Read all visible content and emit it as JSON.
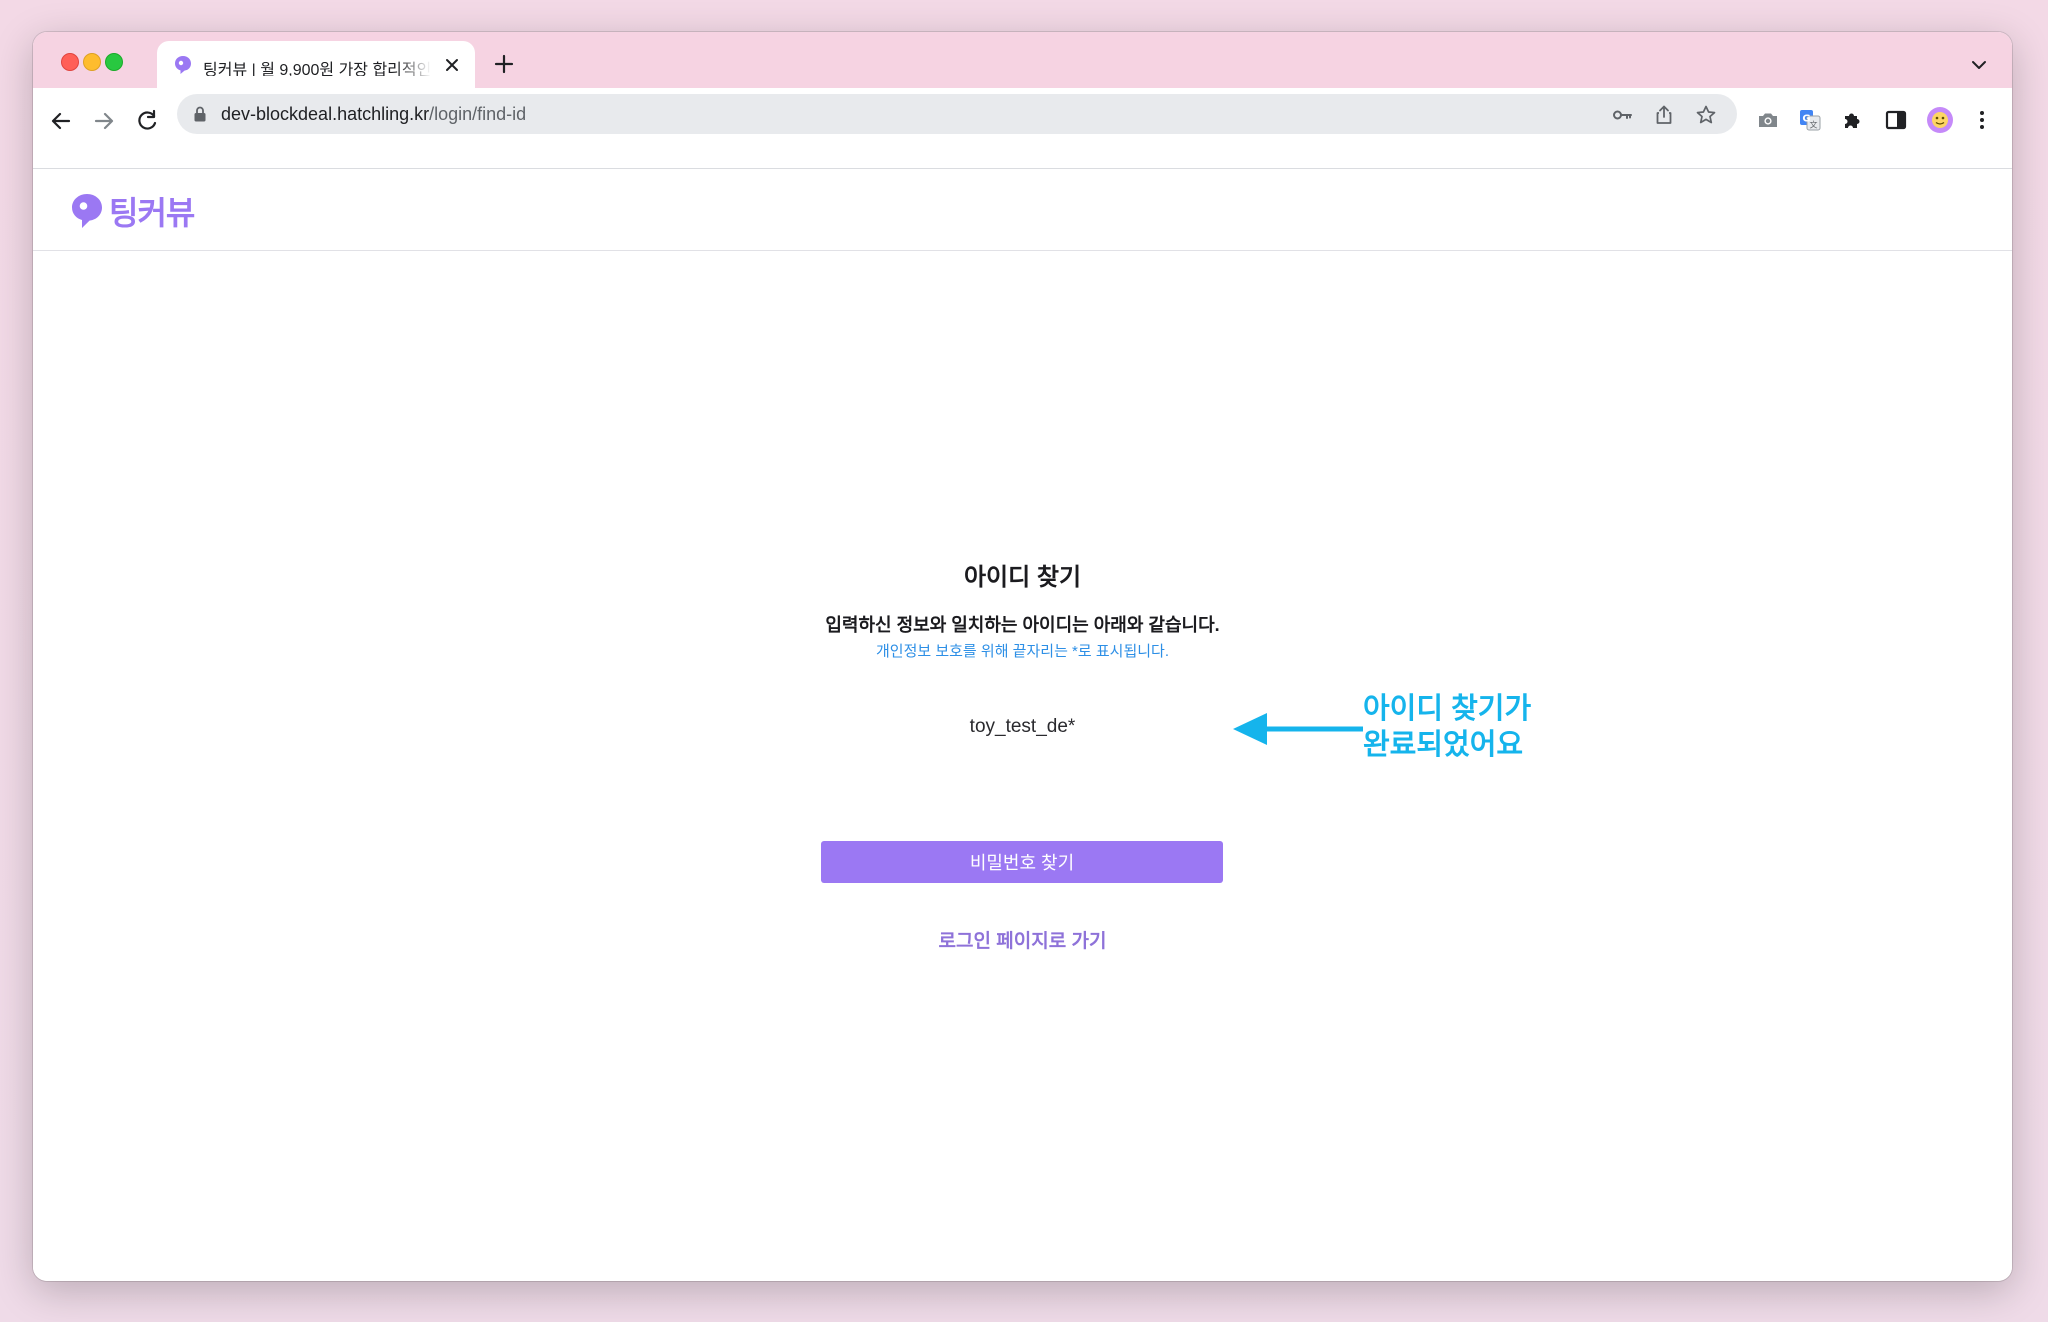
{
  "browser": {
    "tab_title": "팅커뷰 | 월 9,900원 가장 합리적인",
    "url_host": "dev-blockdeal.hatchling.kr",
    "url_path": "/login/find-id"
  },
  "site": {
    "logo_text": "팅커뷰",
    "brand_color": "#9b78f3"
  },
  "find_id": {
    "title": "아이디 찾기",
    "description": "입력하신 정보와 일치하는 아이디는 아래와 같습니다.",
    "privacy_note": "개인정보 보호를 위해 끝자리는 *로 표시됩니다.",
    "found_id": "toy_test_de*",
    "find_password_button": "비밀번호 찾기",
    "login_link": "로그인 페이지로 가기"
  },
  "annotation": {
    "line1": "아이디 찾기가",
    "line2": "완료되었어요",
    "color": "#15b4ec"
  },
  "icons": {
    "favicon": "tinkerview-logo-icon",
    "close": "close-icon",
    "new_tab": "plus-icon",
    "back": "back-arrow-icon",
    "forward": "forward-arrow-icon",
    "reload": "reload-icon",
    "lock": "lock-icon",
    "key": "key-icon",
    "share": "share-icon",
    "bookmark": "star-icon",
    "camera": "camera-icon",
    "translate": "translate-icon",
    "extensions": "puzzle-icon",
    "side_panel": "side-panel-icon",
    "profile": "avatar",
    "menu": "kebab-menu-icon"
  }
}
